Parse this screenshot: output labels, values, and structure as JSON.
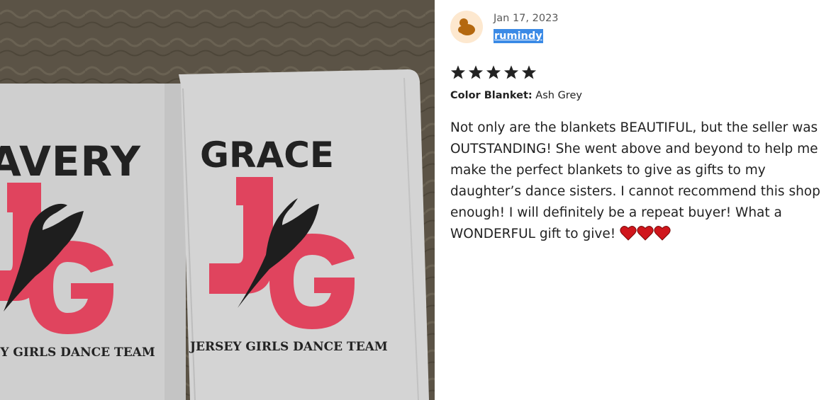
{
  "photo": {
    "left_blanket_name": "AVERY",
    "right_blanket_name": "GRACE",
    "logo_letters": [
      "J",
      "G"
    ],
    "team_name": "JERSEY GIRLS DANCE TEAM"
  },
  "review": {
    "date": "Jan 17, 2023",
    "username": "rumindy",
    "rating": 5,
    "variation_label": "Color Blanket:",
    "variation_value": "Ash Grey",
    "text": "Not only are the blankets BEAUTIFUL, but the seller was OUTSTANDING! She went above and beyond to help me make the perfect blankets to give as gifts to my daughter’s dance sisters. I cannot recommend this shop enough! I will definitely be a repeat buyer! What a WONDERFUL gift to give!",
    "hearts": 3
  },
  "colors": {
    "blanket": "#cfcfcf",
    "logo_pink": "#e0445e",
    "couch": "#5b5346",
    "highlight": "#3b8ae6",
    "star": "#222222",
    "heart": "#d0161c"
  },
  "icons": {
    "avatar": "avatar-icon",
    "star": "star-icon",
    "heart": "heart-icon"
  }
}
